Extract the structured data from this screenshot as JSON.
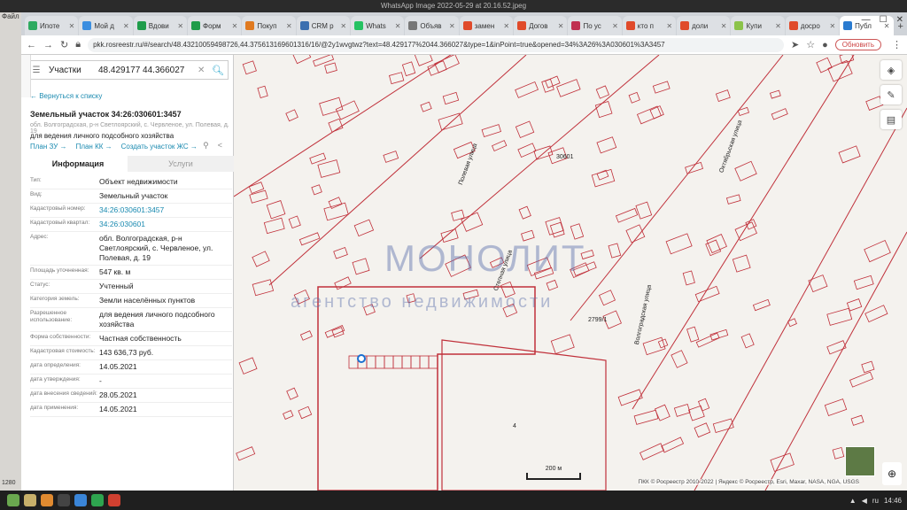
{
  "outer": {
    "title": "WhatsApp Image 2022-05-29 at 20.16.52.jpeg",
    "left_top": "Файл",
    "left_bottom": "1280"
  },
  "browser": {
    "tabs": [
      {
        "label": "Ипоте",
        "color": "#2eaa60"
      },
      {
        "label": "Мой д",
        "color": "#3b8ee0"
      },
      {
        "label": "Вдови",
        "color": "#1f9c4a"
      },
      {
        "label": "Форм",
        "color": "#1f9c4a"
      },
      {
        "label": "Покуп",
        "color": "#e07a20"
      },
      {
        "label": "CRM р",
        "color": "#3b6fb0"
      },
      {
        "label": "Whats",
        "color": "#25c262"
      },
      {
        "label": "Объяв",
        "color": "#777"
      },
      {
        "label": "замен",
        "color": "#e04a2a"
      },
      {
        "label": "Догов",
        "color": "#e04a2a"
      },
      {
        "label": "По ус",
        "color": "#c03050"
      },
      {
        "label": "кто п",
        "color": "#e04a2a"
      },
      {
        "label": "доли",
        "color": "#e04a2a"
      },
      {
        "label": "Купи",
        "color": "#8bc34a"
      },
      {
        "label": "досро",
        "color": "#e04a2a"
      },
      {
        "label": "Публ",
        "color": "#2a7bd0",
        "active": true
      }
    ],
    "url": "pkk.rosreestr.ru/#/search/48.43210059498726,44.375613169601316/16/@2y1wvgtwz?text=48.429177%2044.366027&type=1&inPoint=true&opened=34%3A26%3A030601%3A3457",
    "update_label": "Обновить"
  },
  "panel": {
    "search_category": "Участки",
    "search_query": "48.429177 44.366027",
    "back_label": "← Вернуться к списку",
    "title": "Земельный участок 34:26:030601:3457",
    "address_line": "обл. Волгоградская, р-н Светлоярский, с. Червленое, ул. Полевая, д. 19",
    "purpose_line": "для ведения личного подсобного хозяйства",
    "links": [
      "План ЗУ →",
      "План КК →",
      "Создать участок ЖС →"
    ],
    "tab_info": "Информация",
    "tab_services": "Услуги",
    "rows": [
      {
        "k": "Тип:",
        "v": "Объект недвижимости"
      },
      {
        "k": "Вид:",
        "v": "Земельный участок"
      },
      {
        "k": "Кадастровый номер:",
        "v": "34:26:030601:3457",
        "link": true
      },
      {
        "k": "Кадастровый квартал:",
        "v": "34:26:030601",
        "link": true
      },
      {
        "k": "Адрес:",
        "v": "обл. Волгоградская, р-н Светлоярский, с. Червленое, ул. Полевая, д. 19"
      },
      {
        "k": "Площадь уточненная:",
        "v": "547 кв. м"
      },
      {
        "k": "Статус:",
        "v": "Учтенный"
      },
      {
        "k": "Категория земель:",
        "v": "Земли населённых пунктов"
      },
      {
        "k": "Разрешенное использование:",
        "v": "для ведения личного подсобного хозяйства"
      },
      {
        "k": "Форма собственности:",
        "v": "Частная собственность"
      },
      {
        "k": "Кадастровая стоимость:",
        "v": "143 636,73 руб."
      },
      {
        "k": "дата определения:",
        "v": "14.05.2021"
      },
      {
        "k": "дата утверждения:",
        "v": "-"
      },
      {
        "k": "дата внесения сведений:",
        "v": "28.05.2021"
      },
      {
        "k": "дата применения:",
        "v": "14.05.2021"
      }
    ]
  },
  "map": {
    "labels": [
      "30601",
      "Полевая улица",
      "Октябрьская улица",
      "Степная улица",
      "Волгоградская улица",
      "2799/1",
      "4"
    ],
    "watermark_main": "МОНОЛИТ",
    "watermark_sub": "агентство недвижимости",
    "scale": "200 м",
    "attribution": "ПКК © Росреестр 2010-2022 | Яндекс © Росреестр, Esri, Maxar, NASA, NGA, USGS",
    "line_color": "#c0303a"
  },
  "taskbar": {
    "time": "14:46",
    "lang": "ru"
  }
}
